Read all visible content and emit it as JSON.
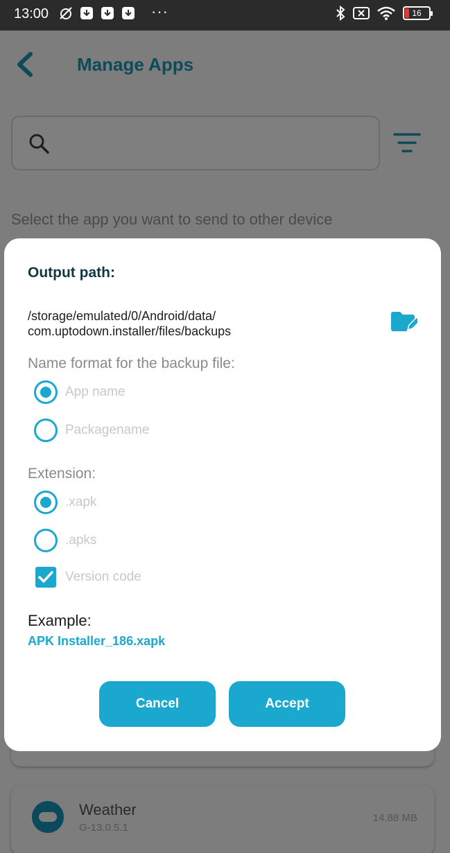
{
  "status_bar": {
    "time": "13:00",
    "dots": "···",
    "battery_level": "16"
  },
  "app_bar": {
    "title": "Manage Apps",
    "back_icon": "chevron-left-icon"
  },
  "search": {
    "icon": "search-icon",
    "value": ""
  },
  "subtitle": "Select the app you want to send to other device",
  "dialog": {
    "title": "Output path:",
    "path_line1": "/storage/emulated/0/Android/data/",
    "path_line2": "com.uptodown.installer/files/backups",
    "folder_icon": "folder-edit-icon",
    "name_format_label": "Name format for the backup file:",
    "name_options": [
      {
        "label": "App name",
        "selected": true
      },
      {
        "label": "Packagename",
        "selected": false
      }
    ],
    "extension_label": "Extension:",
    "extension_options": [
      {
        "label": ".xapk",
        "selected": true
      },
      {
        "label": ".apks",
        "selected": false
      }
    ],
    "version_code": {
      "label": "Version code",
      "checked": true
    },
    "example_label": "Example:",
    "example_value": "APK Installer_186.xapk",
    "cancel_label": "Cancel",
    "accept_label": "Accept",
    "accent_color": "#1aa8cf"
  },
  "app_list": [
    {
      "name": "Weather",
      "version": "G-13.0.5.1",
      "size": "14.88 MB"
    }
  ]
}
